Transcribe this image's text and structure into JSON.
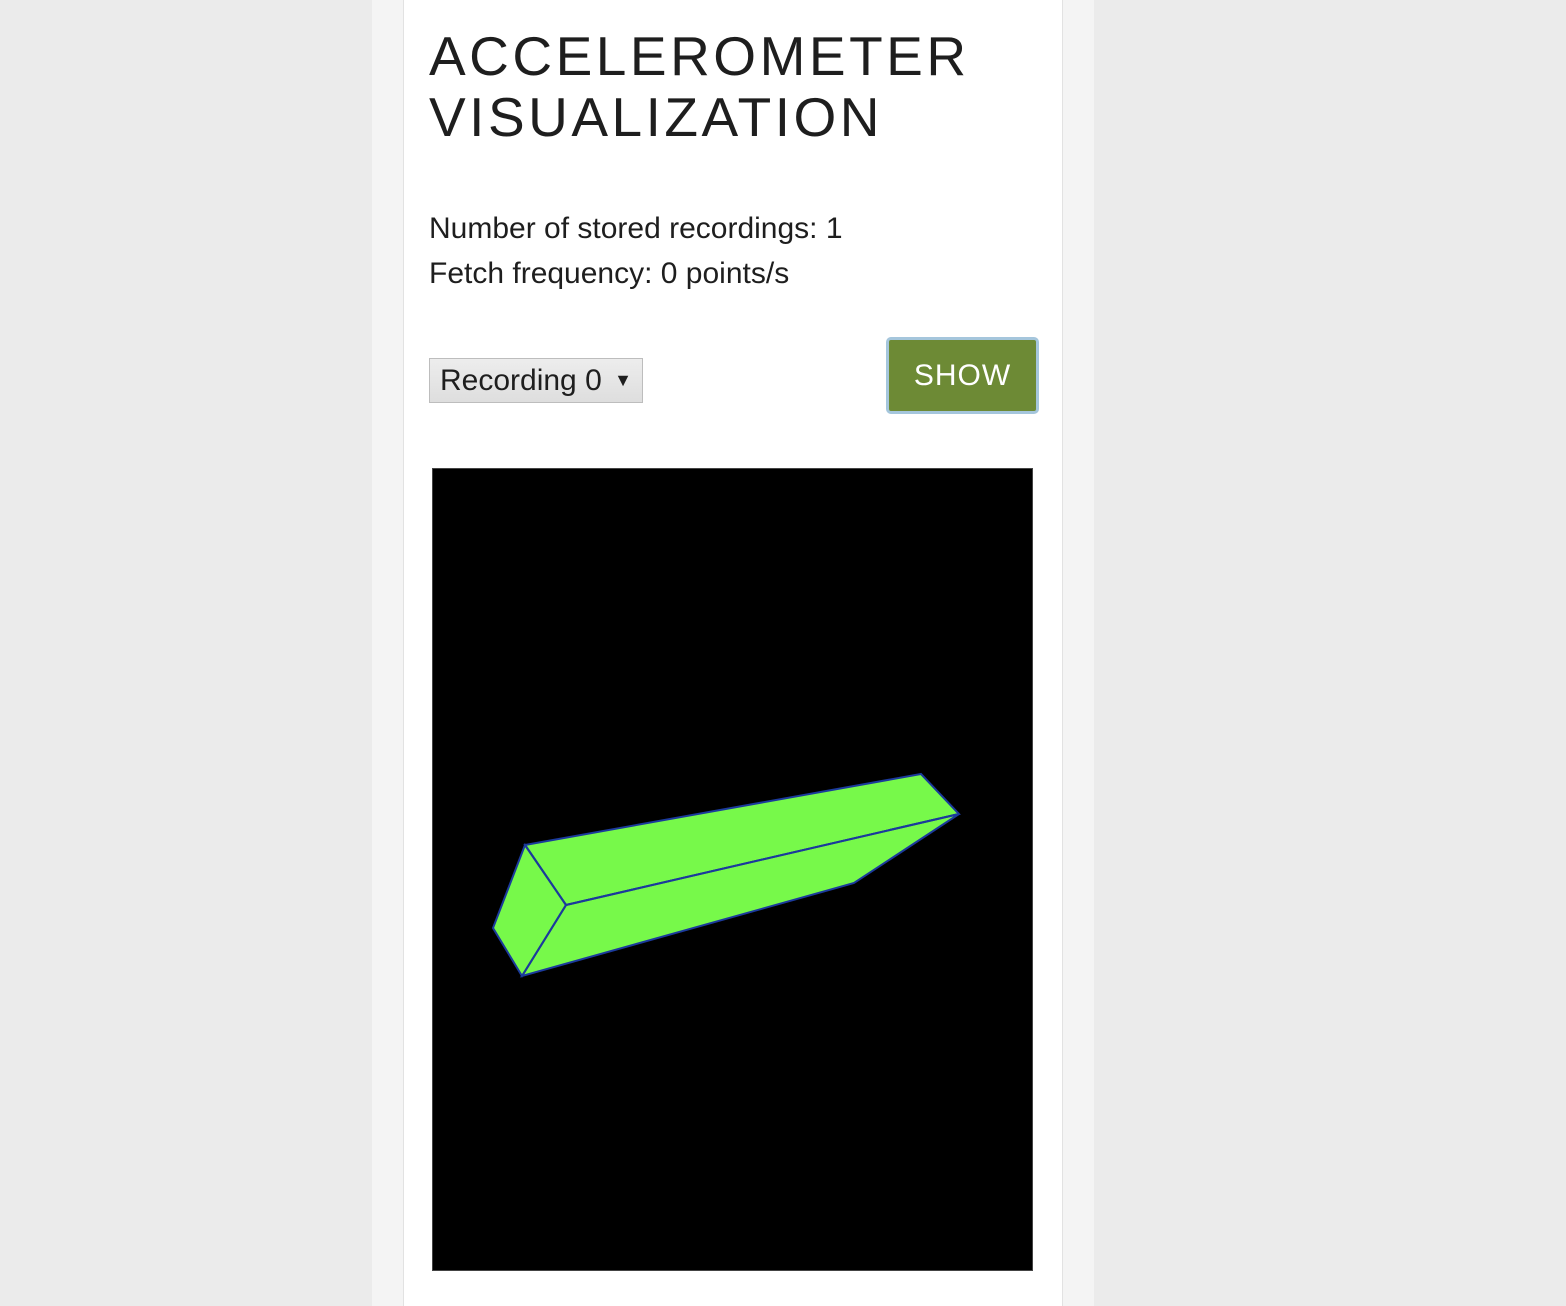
{
  "page": {
    "title": "ACCELEROMETER VISUALIZATION",
    "stored_recordings_text": "Number of stored recordings: 1",
    "fetch_frequency_text": "Fetch frequency: 0 points/s"
  },
  "controls": {
    "recording_select": {
      "selected": "Recording 0",
      "options": [
        "Recording 0"
      ]
    },
    "show_label": "SHOW"
  },
  "colors": {
    "background": "#ebebeb",
    "card": "#ffffff",
    "button": "#6d8a35",
    "button_border": "#a5c6dc",
    "viz_background": "#000000",
    "box_fill": "#77f94a",
    "box_edge": "#1b3a9c"
  },
  "icons": {
    "dropdown": "chevron-down-icon"
  }
}
